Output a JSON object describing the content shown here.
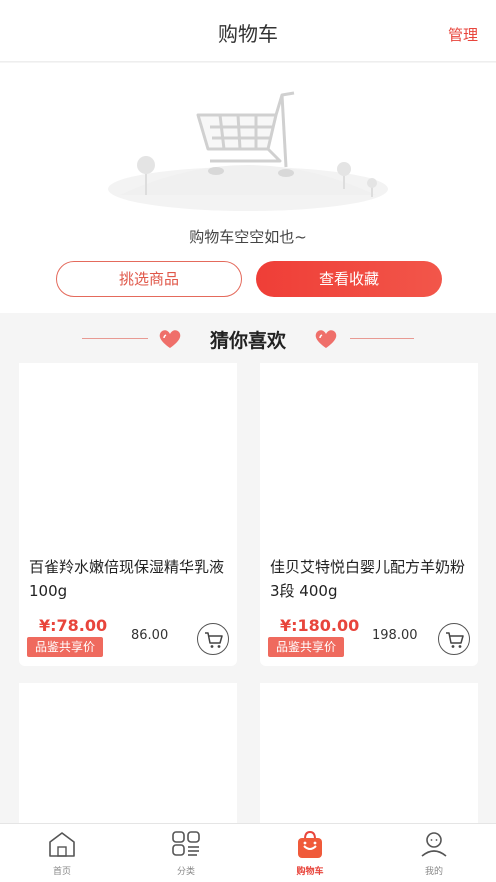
{
  "header": {
    "title": "购物车",
    "manage": "管理"
  },
  "empty": {
    "message": "购物车空空如也~",
    "pick_button": "挑选商品",
    "favorites_button": "查看收藏"
  },
  "recommend": {
    "title": "猜你喜欢"
  },
  "products": [
    {
      "name": "百雀羚水嫩倍现保湿精华乳液100g",
      "price": "¥:78.00",
      "original_price": "86.00",
      "tag": "品鉴共享价"
    },
    {
      "name": "佳贝艾特悦白婴儿配方羊奶粉3段 400g",
      "price": "¥:180.00",
      "original_price": "198.00",
      "tag": "品鉴共享价"
    }
  ],
  "tabbar": {
    "items": [
      {
        "label": "首页",
        "icon": "home-icon"
      },
      {
        "label": "分类",
        "icon": "category-icon"
      },
      {
        "label": "购物车",
        "icon": "cart-bag-icon",
        "active": true
      },
      {
        "label": "我的",
        "icon": "user-icon"
      }
    ]
  },
  "colors": {
    "accent": "#e8453c",
    "tag_bg": "#ef6a5e",
    "background": "#f5f5f5"
  }
}
